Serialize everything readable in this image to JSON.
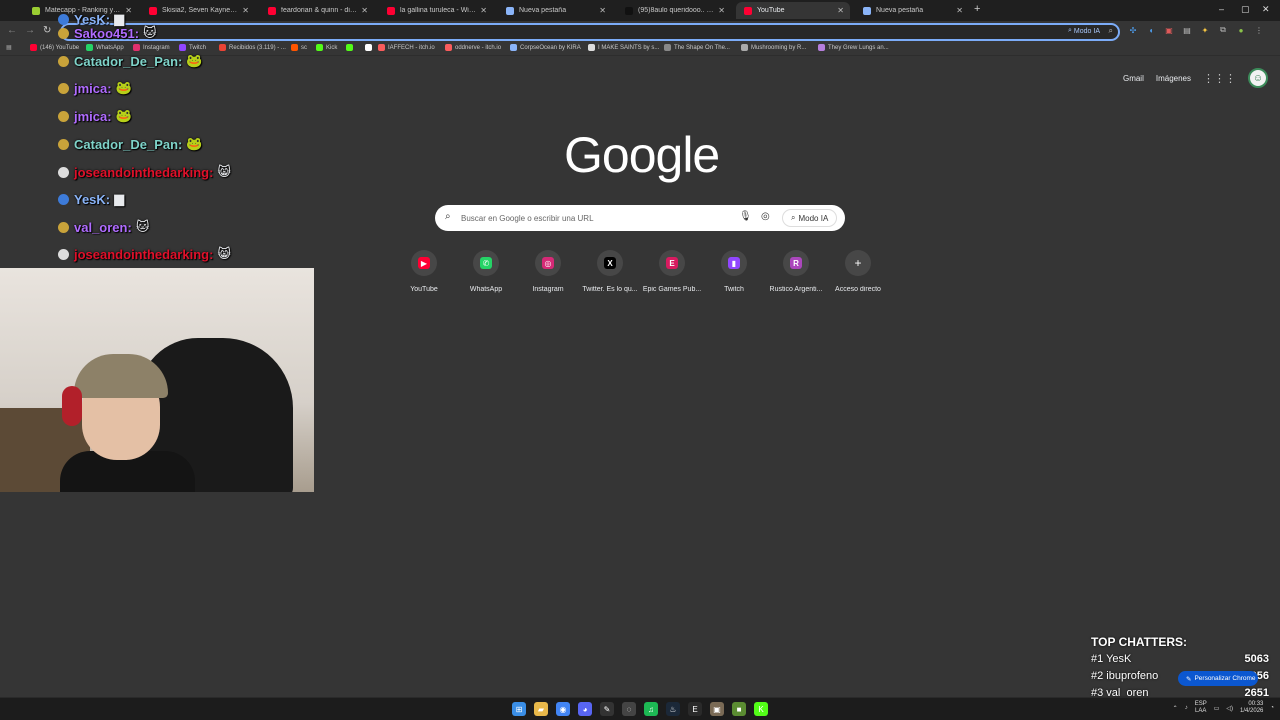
{
  "tabs": [
    {
      "title": "Matecapp - Ranking y reseñas",
      "favicon_color": "#9acd32",
      "close": "✕",
      "active": false
    },
    {
      "title": "Skisia2, Seven Kayne - 123 / ...",
      "favicon_color": "#ff0033",
      "close": "✕",
      "active": false
    },
    {
      "title": "feardorian & quinn - distance ...",
      "favicon_color": "#ff0033",
      "close": "✕",
      "active": false
    },
    {
      "title": "la gallina turuleca - Will y Rex",
      "favicon_color": "#ff0033",
      "close": "✕",
      "active": false
    },
    {
      "title": "Nueva pestaña",
      "favicon_color": "#8ab4f8",
      "close": "✕",
      "active": false
    },
    {
      "title": "(95)8aulo queridooo.. #fyyp #...",
      "favicon_color": "#111111",
      "close": "✕",
      "active": false
    },
    {
      "title": "YouTube",
      "favicon_color": "#ff0033",
      "close": "✕",
      "active": true
    },
    {
      "title": "Nueva pestaña",
      "favicon_color": "#8ab4f8",
      "close": "✕",
      "active": false
    }
  ],
  "tabstrip": {
    "new_tab": "+",
    "minimize": "–",
    "maximize": "▢",
    "close": "✕"
  },
  "toolbar": {
    "back": "←",
    "forward": "→",
    "reload": "↻",
    "omnibox_value": "",
    "omnibox_ai": "Modo IA",
    "zoom": "⌕"
  },
  "bookmarks": [
    {
      "label": "(146) YouTube",
      "color": "#ff0033"
    },
    {
      "label": "WhatsApp",
      "color": "#25d366"
    },
    {
      "label": "Instagram",
      "color": "#e1306c"
    },
    {
      "label": "Twitch",
      "color": "#9146ff"
    },
    {
      "label": "Recibidos (3.119) - ...",
      "color": "#ea4335"
    },
    {
      "label": "sc",
      "color": "#ff5500"
    },
    {
      "label": "Kick",
      "color": "#53fc18"
    },
    {
      "label": "",
      "color": "#53fc18"
    },
    {
      "label": "",
      "color": "#ffffff"
    },
    {
      "label": "IAFFECH - itch.io",
      "color": "#fa5c5c"
    },
    {
      "label": "oddnerve - itch.io",
      "color": "#fa5c5c"
    },
    {
      "label": "CorpseOcean by KIRA",
      "color": "#8ab4f8"
    },
    {
      "label": "I MAKE SAINTS by s...",
      "color": "#dddddd"
    },
    {
      "label": "The Shape On The...",
      "color": "#888888"
    },
    {
      "label": "Mushrooming by R...",
      "color": "#aaaaaa"
    },
    {
      "label": "They Grew Lungs an...",
      "color": "#b57edc"
    }
  ],
  "ntp": {
    "gmail": "Gmail",
    "images": "Imágenes",
    "logo": "Google",
    "search_placeholder": "Buscar en Google o escribir una URL",
    "ai_mode": "Modo IA",
    "shortcuts": [
      {
        "label": "YouTube",
        "icon": "▶",
        "color": "#ff0033"
      },
      {
        "label": "WhatsApp",
        "icon": "✆",
        "color": "#25d366"
      },
      {
        "label": "Instagram",
        "icon": "◎",
        "color": "#d62976"
      },
      {
        "label": "Twitter. Es lo qu...",
        "icon": "X",
        "color": "#000000"
      },
      {
        "label": "Epic Games Pub...",
        "icon": "E",
        "color": "#d81b60"
      },
      {
        "label": "Twitch",
        "icon": "▮",
        "color": "#9146ff"
      },
      {
        "label": "Rustico Argenti...",
        "icon": "R",
        "color": "#ab47bc"
      },
      {
        "label": "Acceso directo",
        "icon": "+",
        "color": "transparent"
      }
    ]
  },
  "chat": [
    {
      "user": "YesK:",
      "color": "#8ab4f8",
      "badge_color": "#3d7bd9"
    },
    {
      "user": "Sakoo451:",
      "color": "#b06cff",
      "badge_color": "#c9a33a"
    },
    {
      "user": "Catador_De_Pan:",
      "color": "#7fd3c9",
      "badge_color": "#c9a33a"
    },
    {
      "user": "jmica:",
      "color": "#b06cff",
      "badge_color": "#c9a33a"
    },
    {
      "user": "jmica:",
      "color": "#b06cff",
      "badge_color": "#c9a33a"
    },
    {
      "user": "Catador_De_Pan:",
      "color": "#7fd3c9",
      "badge_color": "#c9a33a"
    },
    {
      "user": "joseandointhedarking:",
      "color": "#e0102a",
      "badge_color": "#dddddd"
    },
    {
      "user": "YesK:",
      "color": "#8ab4f8",
      "badge_color": "#3d7bd9"
    },
    {
      "user": "val_oren:",
      "color": "#b06cff",
      "badge_color": "#c9a33a"
    },
    {
      "user": "joseandointhedarking:",
      "color": "#e0102a",
      "badge_color": "#dddddd"
    }
  ],
  "top_chatters": {
    "title": "TOP CHATTERS:",
    "rows": [
      {
        "name": "#1 YesK",
        "count": "5063"
      },
      {
        "name": "#2 ibuprofeno",
        "count": "2956"
      },
      {
        "name": "#3 val_oren",
        "count": "2651"
      }
    ]
  },
  "customize": "Personalizar Chrome",
  "taskbar": {
    "icons": [
      {
        "name": "windows-start-icon",
        "glyph": "⊞",
        "color": "#3a8ee6"
      },
      {
        "name": "file-explorer-icon",
        "glyph": "▰",
        "color": "#e8b84a"
      },
      {
        "name": "chrome-icon",
        "glyph": "◉",
        "color": "#4285f4"
      },
      {
        "name": "discord-icon",
        "glyph": "◕",
        "color": "#5865f2"
      },
      {
        "name": "capcut-icon",
        "glyph": "✎",
        "color": "#333333"
      },
      {
        "name": "obs-icon",
        "glyph": "◌",
        "color": "#444444"
      },
      {
        "name": "spotify-icon",
        "glyph": "♫",
        "color": "#1db954"
      },
      {
        "name": "steam-icon",
        "glyph": "♨",
        "color": "#1b2838"
      },
      {
        "name": "epic-games-icon",
        "glyph": "E",
        "color": "#2a2a2a"
      },
      {
        "name": "package-icon",
        "glyph": "▣",
        "color": "#7a6a55"
      },
      {
        "name": "minecraft-icon",
        "glyph": "■",
        "color": "#5b8c32"
      },
      {
        "name": "kick-icon",
        "glyph": "K",
        "color": "#53fc18"
      }
    ],
    "lang_top": "ESP",
    "lang_bottom": "LAA",
    "time": "00:33",
    "date": "1/4/2026"
  }
}
